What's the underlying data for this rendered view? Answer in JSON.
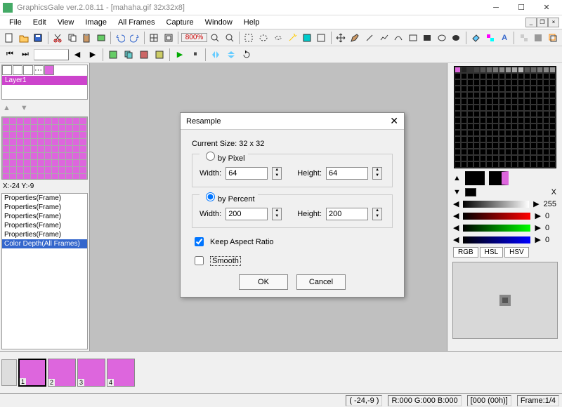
{
  "window": {
    "title": "GraphicsGale ver.2.08.11 - [mahaha.gif 32x32x8]"
  },
  "menus": [
    "File",
    "Edit",
    "View",
    "Image",
    "All Frames",
    "Capture",
    "Window",
    "Help"
  ],
  "toolbar": {
    "xy_input": "",
    "zoom": "800%"
  },
  "left": {
    "layer_name": "Layer1",
    "coord": "X:-24 Y:-9",
    "history": [
      "Properties(Frame)",
      "Properties(Frame)",
      "Properties(Frame)",
      "Properties(Frame)",
      "Properties(Frame)",
      "Color Depth(All Frames)"
    ]
  },
  "right": {
    "value": "255",
    "ch_values": [
      "0",
      "0",
      "0"
    ],
    "tabs": [
      "RGB",
      "HSL",
      "HSV"
    ]
  },
  "timeline": {
    "frames": [
      "1",
      "2",
      "3",
      "4"
    ]
  },
  "status": {
    "coord": "( -24,-9 )",
    "rgb": "R:000 G:000 B:000",
    "time": "[000 (00h)]",
    "frame": "Frame:1/4"
  },
  "dialog": {
    "title": "Resample",
    "current_size": "Current Size: 32 x 32",
    "by_pixel": "by Pixel",
    "by_percent": "by Percent",
    "width_label": "Width:",
    "height_label": "Height:",
    "px_width": "64",
    "px_height": "64",
    "pc_width": "200",
    "pc_height": "200",
    "keep_aspect": "Keep Aspect Ratio",
    "smooth": "Smooth",
    "ok": "OK",
    "cancel": "Cancel"
  }
}
